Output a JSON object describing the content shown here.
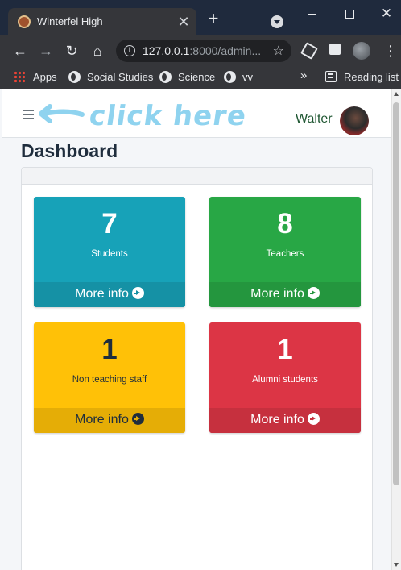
{
  "browser": {
    "tab_title": "Winterfel High",
    "tab_close": "✕",
    "new_tab": "+",
    "url_host": "127.0.0.1",
    "url_rest": ":8000/admin...",
    "window_close": "✕",
    "bookmarks": [
      {
        "label": "Apps",
        "icon": "apps-grid-icon"
      },
      {
        "label": "Social Studies",
        "icon": "globe-icon"
      },
      {
        "label": "Science",
        "icon": "globe-icon"
      },
      {
        "label": "vv",
        "icon": "globe-icon"
      }
    ],
    "more_bookmarks": "»",
    "reading_list": "Reading list"
  },
  "navbar": {
    "annotation": "click here",
    "user_name": "Walter"
  },
  "page": {
    "title": "Dashboard"
  },
  "stats": [
    {
      "count": "7",
      "label": "Students",
      "more": "More info",
      "color": "#17a2b8",
      "footer_color": "#1591a5"
    },
    {
      "count": "8",
      "label": "Teachers",
      "more": "More info",
      "color": "#28a745",
      "footer_color": "#24963e"
    },
    {
      "count": "1",
      "label": "Non teaching staff",
      "more": "More info",
      "color": "#ffc107",
      "footer_color": "#e5ad06"
    },
    {
      "count": "1",
      "label": "Alumni students",
      "more": "More info",
      "color": "#dc3545",
      "footer_color": "#c6303e"
    }
  ]
}
